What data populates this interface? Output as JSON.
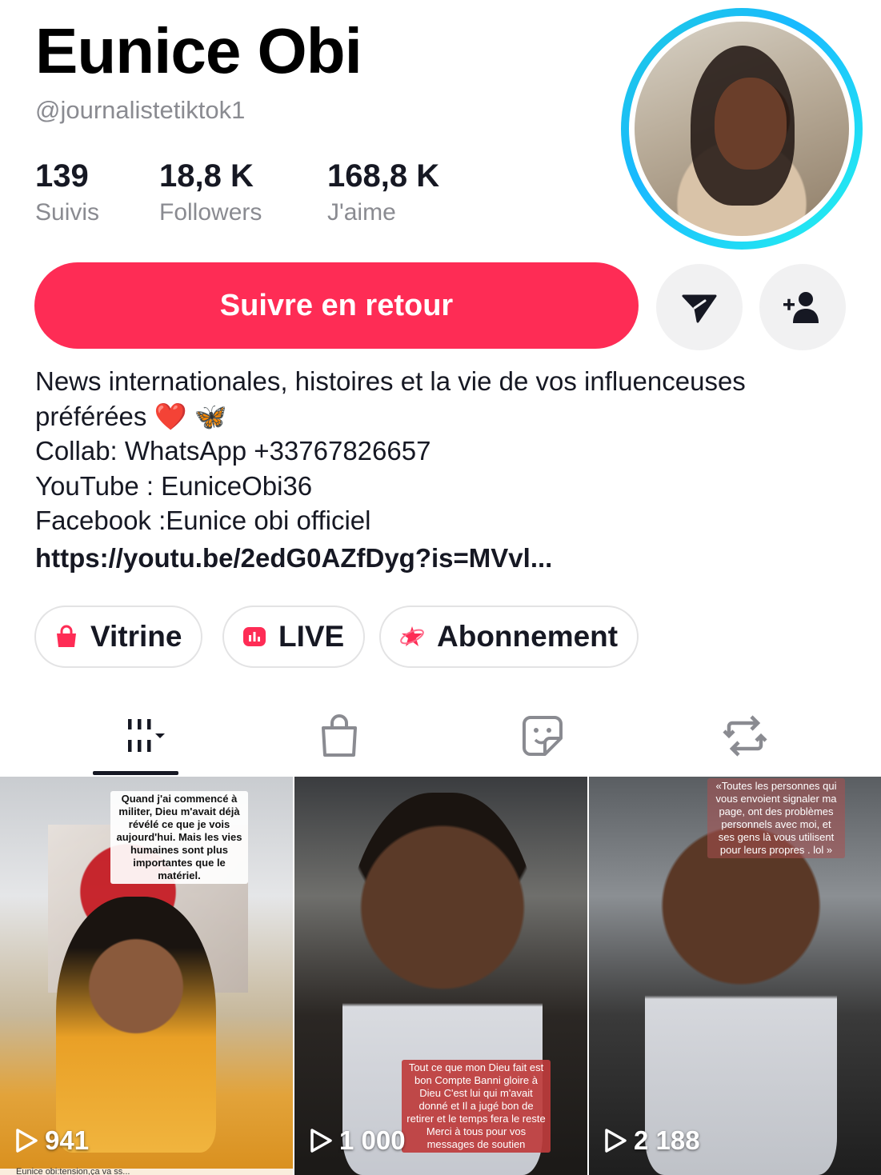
{
  "profile": {
    "name": "Eunice Obi",
    "handle": "@journalistetiktok1"
  },
  "stats": [
    {
      "value": "139",
      "label": "Suivis"
    },
    {
      "value": "18,8 K",
      "label": "Followers"
    },
    {
      "value": "168,8 K",
      "label": "J'aime"
    }
  ],
  "actions": {
    "follow_label": "Suivre en retour",
    "message_icon": "send-icon",
    "add_friend_icon": "add-user-icon"
  },
  "bio": {
    "lines": [
      "News internationales, histoires et la vie de vos influenceuses",
      "préférées ❤️ 🦋",
      "Collab: WhatsApp +33767826657",
      "YouTube : EuniceObi36",
      "Facebook :Eunice obi officiel"
    ],
    "link": "https://youtu.be/2edG0AZfDyg?is=MVvl..."
  },
  "chips": [
    {
      "label": "Vitrine",
      "icon": "shopping-bag-icon"
    },
    {
      "label": "LIVE",
      "icon": "live-icon"
    },
    {
      "label": "Abonnement",
      "icon": "subscription-icon"
    }
  ],
  "tabs": [
    {
      "icon": "videos-grid-icon",
      "active": true
    },
    {
      "icon": "shop-bag-icon",
      "active": false
    },
    {
      "icon": "sticker-icon",
      "active": false
    },
    {
      "icon": "repost-icon",
      "active": false
    }
  ],
  "videos": [
    {
      "views": "941",
      "caption": "Quand j'ai commencé à militer, Dieu m'avait déjà révélé ce que je vois aujourd'hui. Mais les vies humaines sont plus importantes que le matériel.",
      "footer": "Eunice obi:tension,ça va ss..."
    },
    {
      "views": "1 000",
      "caption": "Tout ce que mon Dieu fait est bon Compte Banni gloire à Dieu C'est lui qui m'avait donné et Il a jugé bon de retirer et le temps fera le reste Merci à tous pour vos messages de soutien"
    },
    {
      "views": "2 188",
      "caption": "«Toutes les personnes qui vous envoient signaler ma page, ont des problèmes personnels avec moi, et ses gens là vous utilisent pour leurs propres . lol »"
    }
  ],
  "colors": {
    "accent": "#fe2c55",
    "ring": "#1ecbe1",
    "muted_text": "#8a8b91"
  }
}
